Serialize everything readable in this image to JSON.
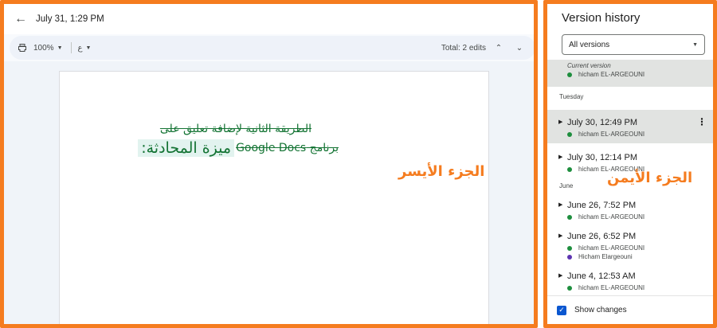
{
  "header": {
    "back_icon": "arrow-back-icon",
    "doc_time": "July 31, 1:29 PM"
  },
  "toolbar": {
    "print_icon": "print-icon",
    "zoom": "100%",
    "input_tools_icon": "input-tools-icon",
    "input_tools_glyph": "ع",
    "total_edits": "Total: 2 edits",
    "prev_icon": "chevron-up-icon",
    "next_icon": "chevron-down-icon"
  },
  "document": {
    "line1_deleted": "الطريقة الثانية لإضافة تعليق على",
    "line2_deleted": "برنامج Google Docs",
    "line2_added": "ميزة المحادثة:"
  },
  "annotations": {
    "left_label": "الجزء الأيسر",
    "right_label": "الجزء الأيمن",
    "frame_color": "#f57c1f"
  },
  "version_history": {
    "title": "Version history",
    "filter": "All versions",
    "current": {
      "label": "Current version",
      "author": "hicham EL-ARGEOUNI",
      "author_color": "#1e8e3e"
    },
    "groups": [
      {
        "heading": "Tuesday",
        "items": [
          {
            "time": "July 30, 12:49 PM",
            "authors": [
              {
                "name": "hicham EL-ARGEOUNI",
                "color": "#1e8e3e"
              }
            ]
          },
          {
            "time": "July 30, 12:14 PM",
            "authors": [
              {
                "name": "hicham EL-ARGEOUNI",
                "color": "#1e8e3e"
              }
            ]
          }
        ]
      },
      {
        "heading": "June",
        "items": [
          {
            "time": "June 26, 7:52 PM",
            "authors": [
              {
                "name": "hicham EL-ARGEOUNI",
                "color": "#1e8e3e"
              }
            ]
          },
          {
            "time": "June 26, 6:52 PM",
            "authors": [
              {
                "name": "hicham EL-ARGEOUNI",
                "color": "#1e8e3e"
              },
              {
                "name": "Hicham Elargeouni",
                "color": "#5e35b1"
              }
            ]
          },
          {
            "time": "June 4, 12:53 AM",
            "authors": [
              {
                "name": "hicham EL-ARGEOUNI",
                "color": "#1e8e3e"
              }
            ]
          }
        ]
      }
    ],
    "show_changes_label": "Show changes",
    "show_changes_checked": true,
    "accent": "#0b57d0"
  }
}
